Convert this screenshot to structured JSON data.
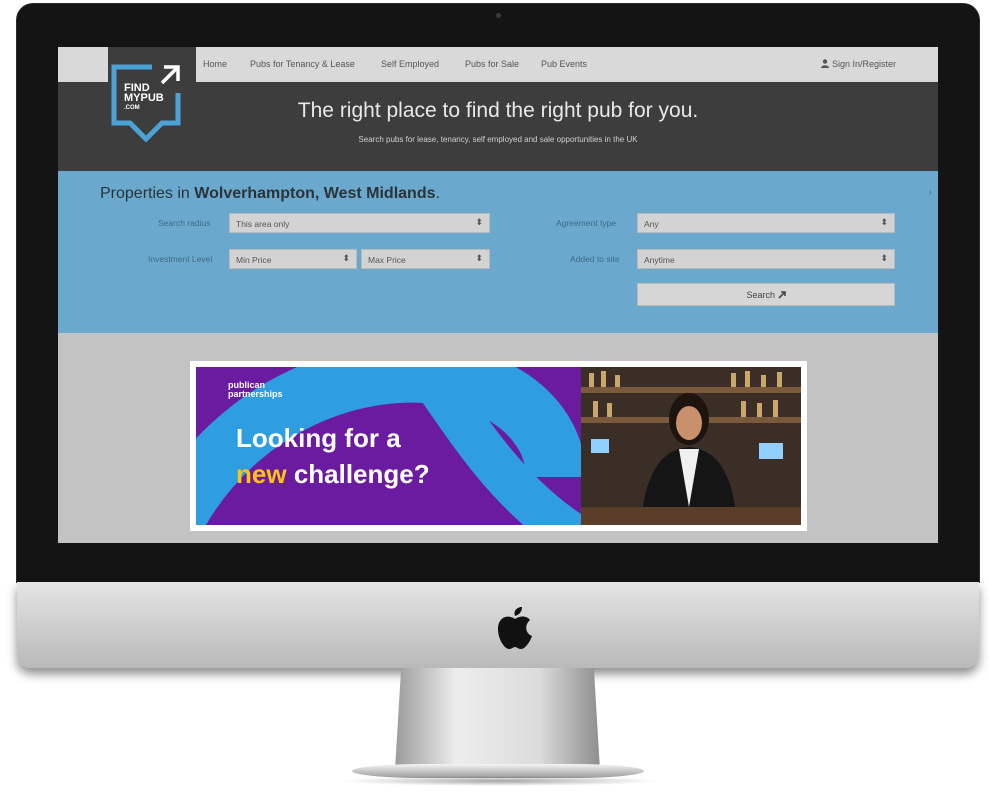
{
  "nav": {
    "items": [
      "Home",
      "Pubs for Tenancy & Lease",
      "Self Employed",
      "Pubs for Sale",
      "Pub Events"
    ],
    "sign_in": "Sign In/Register"
  },
  "logo": {
    "line1": "FIND",
    "line2": "MYPUB",
    "line3": ".COM"
  },
  "hero": {
    "tagline": "The right place to find the right pub for you.",
    "subtagline": "Search pubs for lease, tenancy, self employed and sale opportunities in the UK"
  },
  "search": {
    "title_prefix": "Properties in",
    "location": "Wolverhampton, West Midlands",
    "title_suffix": ".",
    "radius_label": "Search radius",
    "radius_value": "This area only",
    "investment_label": "Investment Level",
    "min_price": "Min Price",
    "max_price": "Max Price",
    "agreement_label": "Agreement type",
    "agreement_value": "Any",
    "added_label": "Added to site",
    "added_value": "Anytime",
    "button": "Search"
  },
  "banner": {
    "brand_line1": "publican",
    "brand_line2": "partnerships",
    "headline_line1": "Looking for a",
    "headline_accent": "new",
    "headline_rest": "challenge?"
  },
  "colors": {
    "hero_bg": "#3d3d3d",
    "panel_bg": "#6aa9cd",
    "logo_blue": "#4aa3d5",
    "banner_purple": "#6a1ba0",
    "banner_blue": "#2f9ee0",
    "banner_accent": "#ffc20e"
  },
  "icons": {
    "user": "user-icon",
    "arrow": "external-arrow-icon",
    "select": "select-arrows-icon",
    "apple": "apple-logo-icon"
  }
}
